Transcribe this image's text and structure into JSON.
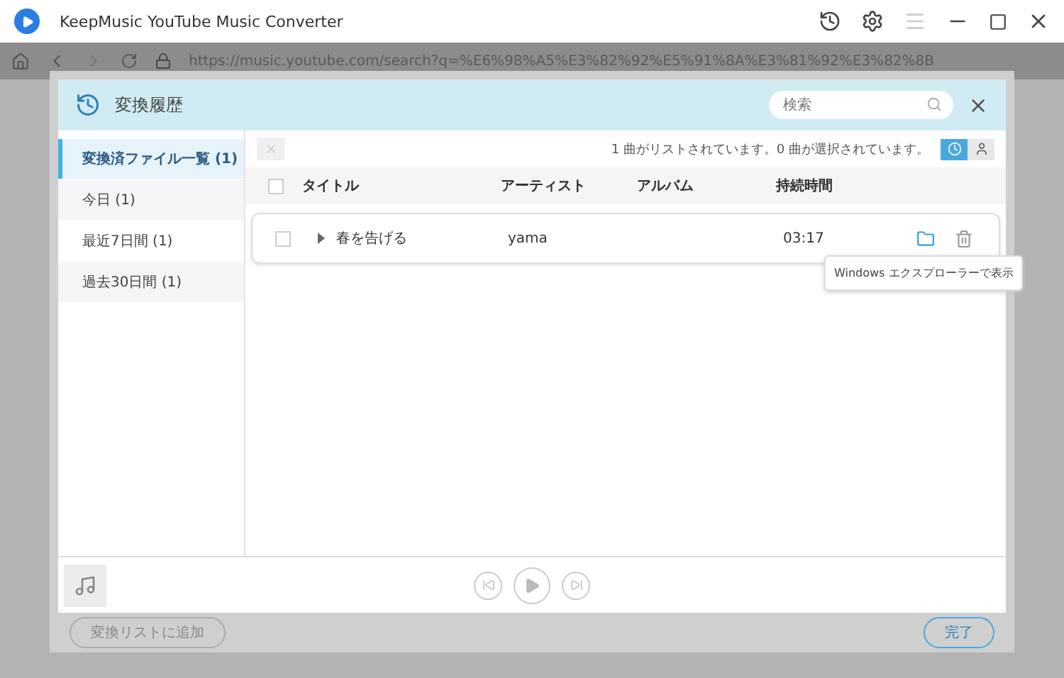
{
  "window": {
    "title": "KeepMusic YouTube Music Converter"
  },
  "address_bar": {
    "url": "https://music.youtube.com/search?q=%E6%98%A5%E3%82%92%E5%91%8A%E3%81%92%E3%82%8B"
  },
  "dialog": {
    "title": "変換履歴",
    "search": {
      "placeholder": "検索"
    }
  },
  "sidebar": {
    "items": [
      {
        "label": "変換済ファイル一覧 (1)",
        "selected": true
      },
      {
        "label": "今日 (1)",
        "selected": false
      },
      {
        "label": "最近7日間 (1)",
        "selected": false
      },
      {
        "label": "過去30日間 (1)",
        "selected": false
      }
    ]
  },
  "status": "1 曲がリストされています。0 曲が選択されています。",
  "view_toggle": [
    {
      "kind": "clock",
      "selected": true
    },
    {
      "kind": "person",
      "selected": false
    }
  ],
  "table": {
    "header_checked": false,
    "columns": [
      "タイトル",
      "アーティスト",
      "アルバム",
      "持続時間"
    ],
    "rows": [
      {
        "checked": false,
        "title": "春を告げる",
        "artist": "yama",
        "album": "",
        "duration": "03:17"
      }
    ]
  },
  "tooltip": "Windows エクスプローラーで表示",
  "background_buttons": [
    "変換リストに追加",
    "完了"
  ]
}
